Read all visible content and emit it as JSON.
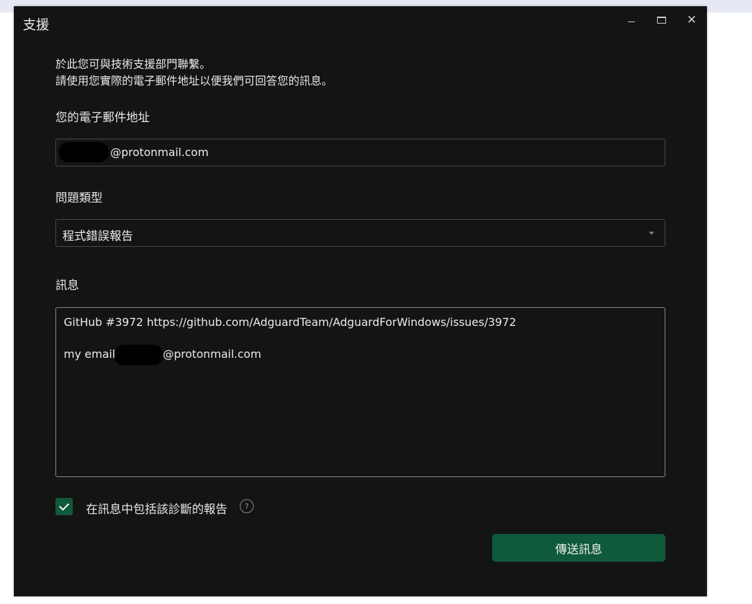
{
  "window": {
    "title": "支援",
    "controls": {
      "minimize": "minimize-icon",
      "maximize": "maximize-icon",
      "close": "close-icon"
    }
  },
  "intro": {
    "line1": "於此您可與技術支援部門聯繫。",
    "line2": "請使用您實際的電子郵件地址以便我們可回答您的訊息。"
  },
  "email": {
    "label": "您的電子郵件地址",
    "value": "@protonmail.com"
  },
  "issue_type": {
    "label": "問題類型",
    "selected": "程式錯誤報告"
  },
  "message": {
    "label": "訊息",
    "line1": "GitHub #3972 https://github.com/AdguardTeam/AdguardForWindows/issues/3972",
    "line2_prefix": "my email:",
    "line2_suffix": "@protonmail.com"
  },
  "diagnostics": {
    "checked": true,
    "label": "在訊息中包括該診斷的報告",
    "help_icon": "?"
  },
  "send_button": "傳送訊息",
  "colors": {
    "window_bg": "#141414",
    "accent": "#0e5a3a",
    "text": "#e8e8e8"
  }
}
